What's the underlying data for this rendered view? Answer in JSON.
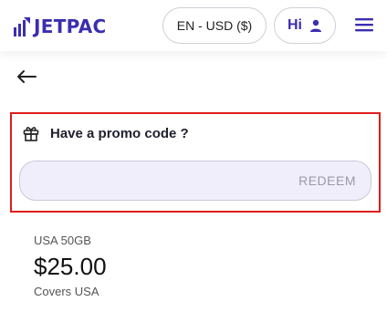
{
  "header": {
    "logo_text": "JETPAC",
    "currency_label": "EN - USD ($)",
    "greeting": "Hi",
    "brand_color": "#3b2eb0",
    "icons": {
      "logo": "bar-chart-logo-icon",
      "user": "user-icon",
      "menu": "hamburger-menu-icon"
    }
  },
  "nav": {
    "back_icon": "arrow-left-icon"
  },
  "promo": {
    "title": "Have a promo code ?",
    "input_value": "",
    "redeem_label": "REDEEM",
    "gift_icon": "gift-icon",
    "highlight_color": "#e11d1d",
    "input_bg": "#f1eefc"
  },
  "plan": {
    "name": "USA 50GB",
    "price": "$25.00",
    "coverage": "Covers USA"
  }
}
